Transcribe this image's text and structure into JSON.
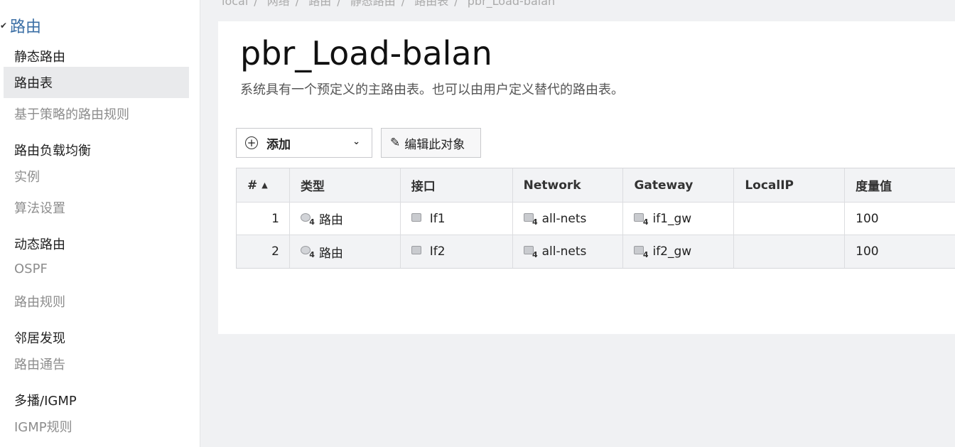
{
  "breadcrumb": [
    "local",
    "网络",
    "路由",
    "静态路由",
    "路由表",
    "pbr_Load-balan"
  ],
  "sidebar": {
    "section": "路由",
    "static_routing": "静态路由",
    "route_table": "路由表",
    "policy_rules": "基于策略的路由规则",
    "load_balancing": "路由负载均衡",
    "instances": "实例",
    "algorithm": "算法设置",
    "dynamic_routing": "动态路由",
    "ospf": "OSPF",
    "route_rules": "路由规则",
    "neighbor_discovery": "邻居发现",
    "route_advert": "路由通告",
    "multicast": "多播/IGMP",
    "igmp_rules": "IGMP规则"
  },
  "main": {
    "title": "pbr_Load-balan",
    "description": "系统具有一个预定义的主路由表。也可以由用户定义替代的路由表。",
    "add_label": "添加",
    "edit_label": "编辑此对象"
  },
  "table": {
    "headers": [
      "#",
      "类型",
      "接口",
      "Network",
      "Gateway",
      "LocalIP",
      "度量值"
    ],
    "rows": [
      {
        "num": "1",
        "type": "路由",
        "iface": "If1",
        "network": "all-nets",
        "gateway": "if1_gw",
        "localip": "",
        "metric": "100"
      },
      {
        "num": "2",
        "type": "路由",
        "iface": "If2",
        "network": "all-nets",
        "gateway": "if2_gw",
        "localip": "",
        "metric": "100"
      }
    ]
  },
  "icons": {
    "type": "route-icon",
    "iface": "interface-icon",
    "network": "network-object-icon",
    "gateway": "gateway-object-icon",
    "badge": "4"
  }
}
